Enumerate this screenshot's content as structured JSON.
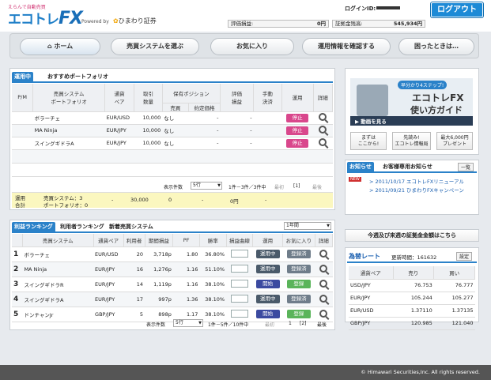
{
  "header": {
    "logo_top": "えらんで自動売買",
    "logo_main": "エコトレ",
    "logo_fx": "FX",
    "powered_by": "Powered by",
    "company": "ひまわり証券",
    "login_id_label": "ログインID:",
    "logout": "ログアウト",
    "eval_label": "評価損益:",
    "eval_value": "0円",
    "margin_label": "証拠金残高:",
    "margin_value": "545,934円"
  },
  "nav": {
    "home": "ホーム",
    "choose": "売買システムを選ぶ",
    "favorites": "お気に入り",
    "check": "運用情報を確認する",
    "help": "困ったときは…"
  },
  "portfolio": {
    "tab_active": "運用中",
    "tab_other": "おすすめポートフォリオ",
    "headers": {
      "pm": "P/M",
      "system": "売買システム",
      "portfolio": "ポートフォリオ",
      "pair1": "通貨",
      "pair2": "ペア",
      "qty1": "取引",
      "qty2": "数量",
      "position": "保有ポジション",
      "buysell": "売買",
      "price": "約定価格",
      "eval1": "評価",
      "eval2": "損益",
      "manual1": "手動",
      "manual2": "決済",
      "operation": "運用",
      "detail": "詳細"
    },
    "rows": [
      {
        "name": "ボラーチェ",
        "pair": "EUR/USD",
        "qty": "10,000",
        "buysell": "なし",
        "price": "-",
        "eval": "-",
        "status": "停止"
      },
      {
        "name": "MA Ninja",
        "pair": "EUR/JPY",
        "qty": "10,000",
        "buysell": "なし",
        "price": "-",
        "eval": "-",
        "status": "停止"
      },
      {
        "name": "スイングギドラA",
        "pair": "EUR/JPY",
        "qty": "10,000",
        "buysell": "なし",
        "price": "-",
        "eval": "-",
        "status": "停止"
      }
    ],
    "display_count_label": "表示件数",
    "display_count": "5行",
    "range": "1件－3件／3件中",
    "first": "最初",
    "page": "[1]",
    "last": "最後",
    "total": {
      "label1": "運用",
      "label2": "合計",
      "sys": "売買システム：3",
      "pf": "ポートフォリオ：0",
      "pair": "-",
      "qty": "30,000",
      "pos": "0",
      "price": "-",
      "eval": "0円",
      "manual": "-"
    }
  },
  "ranking": {
    "tab1": "利益ランキング",
    "tab2": "利用者ランキング",
    "tab3": "新着売買システム",
    "period": "1年間",
    "headers": {
      "system": "売買システム",
      "pair": "通貨ペア",
      "users": "利用者",
      "profit": "期間損益",
      "pf": "PF",
      "win": "勝率",
      "curve": "損益曲線",
      "operation": "運用",
      "favorite": "お気に入り",
      "detail": "詳細"
    },
    "rows": [
      {
        "rank": "1",
        "name": "ボラーチェ",
        "pair": "EUR/USD",
        "users": "20",
        "profit": "3,718p",
        "pf": "1.80",
        "win": "36.80%",
        "op": "運用中",
        "fav": "登録済"
      },
      {
        "rank": "2",
        "name": "MA Ninja",
        "pair": "EUR/JPY",
        "users": "16",
        "profit": "1,276p",
        "pf": "1.16",
        "win": "51.10%",
        "op": "運用中",
        "fav": "登録済"
      },
      {
        "rank": "3",
        "name": "スイングギドラR",
        "pair": "EUR/JPY",
        "users": "14",
        "profit": "1,119p",
        "pf": "1.16",
        "win": "38.10%",
        "op": "開始",
        "fav": "登録"
      },
      {
        "rank": "4",
        "name": "スイングギドラA",
        "pair": "EUR/JPY",
        "users": "17",
        "profit": "997p",
        "pf": "1.36",
        "win": "38.10%",
        "op": "運用中",
        "fav": "登録済"
      },
      {
        "rank": "5",
        "name": "ドンチャンJr",
        "pair": "GBP/JPY",
        "users": "5",
        "profit": "898p",
        "pf": "1.17",
        "win": "38.10%",
        "op": "開始",
        "fav": "登録"
      }
    ],
    "display_count_label": "表示件数",
    "display_count": "5行",
    "range": "1件－5件／10件中",
    "first": "最初",
    "p1": "1",
    "p2": "[2]",
    "last": "最後"
  },
  "side": {
    "guide_badge": "早分かり4ステップ!",
    "guide_title1": "エコトレFX",
    "guide_title2": "使い方ガイド",
    "guide_video": "動画を見る",
    "btn1a": "まずは",
    "btn1b": "ここから!",
    "btn2a": "先読み!",
    "btn2b": "エコトレ情報局",
    "btn3a": "最大6,000円",
    "btn3b": "プレゼント",
    "news_tab1": "お知らせ",
    "news_tab2": "お客様専用お知らせ",
    "news_list": "一覧",
    "news_new": "NEW",
    "news": [
      {
        "text": "2011/10/17 エコトレFXリニューアル"
      },
      {
        "text": "2011/09/21 ひまわりFXキャンペーン"
      }
    ],
    "margin_link": "今週及び来週の証拠金金額はこちら",
    "rate_title": "為替レート",
    "rate_update_label": "更新時間：",
    "rate_update": "161632",
    "rate_settings": "設定",
    "rate_headers": {
      "pair": "通貨ペア",
      "sell": "売り",
      "buy": "買い"
    },
    "rates": [
      {
        "pair": "USD/JPY",
        "sell": "76.753",
        "buy": "76.777"
      },
      {
        "pair": "EUR/JPY",
        "sell": "105.244",
        "buy": "105.277"
      },
      {
        "pair": "EUR/USD",
        "sell": "1.37110",
        "buy": "1.37135"
      },
      {
        "pair": "GBP/JPY",
        "sell": "120.985",
        "buy": "121.040"
      }
    ]
  },
  "footer": {
    "copyright": "© Himawari Securities,Inc. All rights reserved."
  }
}
